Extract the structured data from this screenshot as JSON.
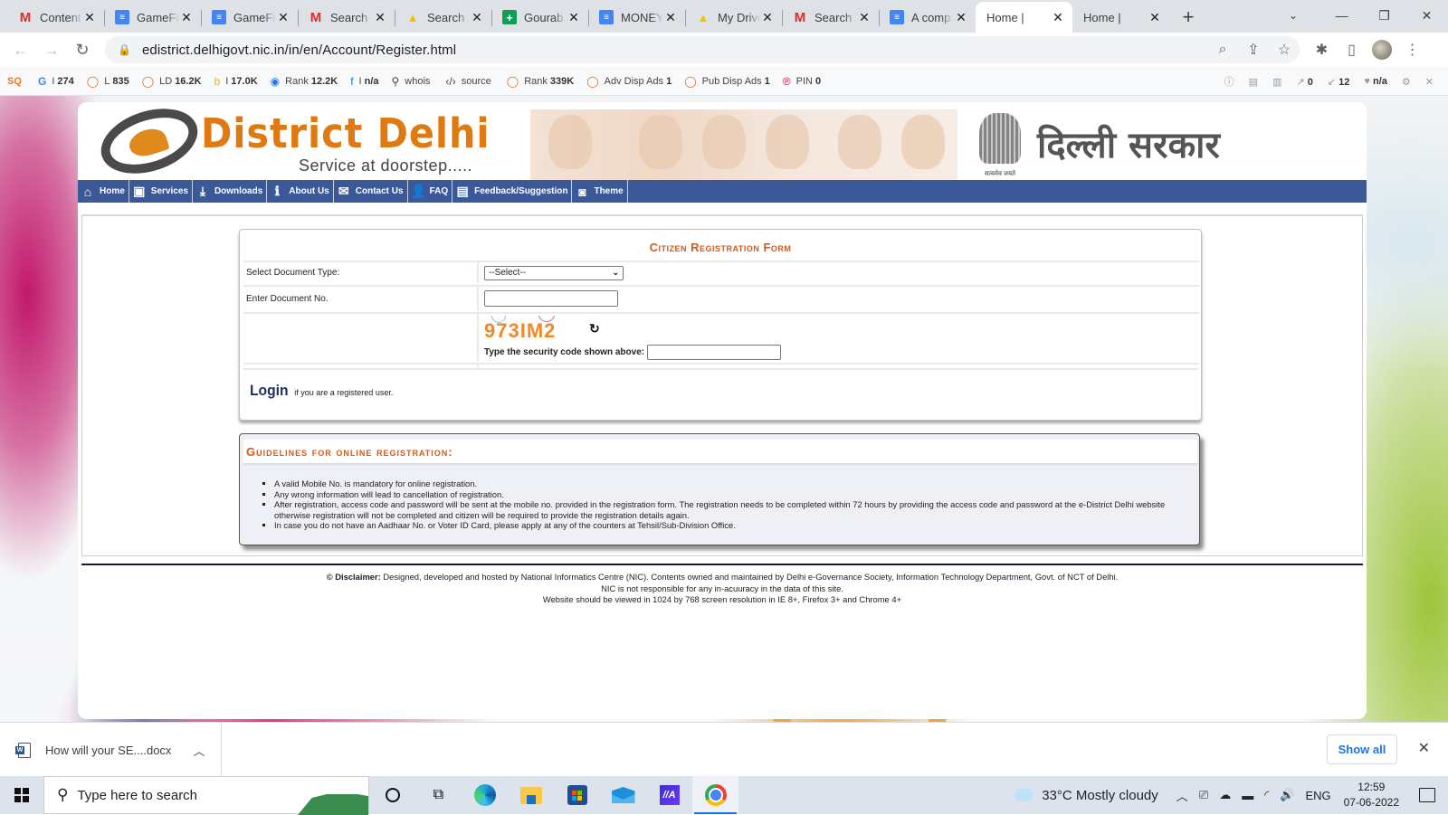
{
  "browser": {
    "tabs": [
      {
        "label": "Content",
        "favicon": "gmail-icon",
        "active": false
      },
      {
        "label": "GameFi",
        "favicon": "google-docs-icon",
        "active": false
      },
      {
        "label": "GameFi",
        "favicon": "google-docs-icon",
        "active": false
      },
      {
        "label": "Search",
        "favicon": "gmail-icon",
        "active": false
      },
      {
        "label": "Search",
        "favicon": "google-drive-icon",
        "active": false
      },
      {
        "label": "Gourab",
        "favicon": "google-sheets-icon",
        "active": false
      },
      {
        "label": "MONEY",
        "favicon": "google-docs-icon",
        "active": false
      },
      {
        "label": "My Drive",
        "favicon": "google-drive-icon",
        "active": false
      },
      {
        "label": "Search",
        "favicon": "gmail-icon",
        "active": false
      },
      {
        "label": "A comp",
        "favicon": "google-docs-icon",
        "active": false
      },
      {
        "label": "Home |",
        "favicon": "national-emblem-icon",
        "active": true
      },
      {
        "label": "Home |",
        "favicon": "national-emblem-icon",
        "active": false
      }
    ],
    "new_tab_label": "+",
    "close_glyph": "✕",
    "url": "edistrict.delhigovt.nic.in/in/en/Account/Register.html"
  },
  "seo_bar": {
    "items": [
      {
        "icon": "google-icon",
        "glyph": "G",
        "label": "I",
        "value": "274"
      },
      {
        "icon": "link-icon",
        "glyph": "◯",
        "label": "L",
        "value": "835"
      },
      {
        "icon": "link-icon",
        "glyph": "◯",
        "label": "LD",
        "value": "16.2K"
      },
      {
        "icon": "bing-icon",
        "glyph": "b",
        "label": "I",
        "value": "17.0K"
      },
      {
        "icon": "alexa-icon",
        "glyph": "◉",
        "label": "Rank",
        "value": "12.2K"
      },
      {
        "icon": "facebook-icon",
        "glyph": "f",
        "label": "I",
        "value": "n/a"
      },
      {
        "icon": "whois-icon",
        "glyph": "⚲",
        "label": "whois",
        "value": ""
      },
      {
        "icon": "source-icon",
        "glyph": "‹/›",
        "label": "source",
        "value": ""
      },
      {
        "icon": "rank-icon",
        "glyph": "◯",
        "label": "Rank",
        "value": "339K"
      },
      {
        "icon": "ads-icon",
        "glyph": "◯",
        "label": "Adv Disp Ads",
        "value": "1"
      },
      {
        "icon": "ads-icon",
        "glyph": "◯",
        "label": "Pub Disp Ads",
        "value": "1"
      },
      {
        "icon": "pinterest-icon",
        "glyph": "℗",
        "label": "PIN",
        "value": "0"
      }
    ],
    "right": {
      "external_links": "0",
      "internal_links": "12",
      "status": "n/a"
    }
  },
  "site": {
    "brand": "District Delhi",
    "tagline": "Service at doorstep.....",
    "govt_title": "दिल्ली सरकार",
    "emblem_motto": "सत्यमेव जयते",
    "nav": [
      {
        "label": "Home",
        "icon": "home-icon",
        "glyph": "⌂"
      },
      {
        "label": "Services",
        "icon": "briefcase-icon",
        "glyph": "▣"
      },
      {
        "label": "Downloads",
        "icon": "download-icon",
        "glyph": "⤓"
      },
      {
        "label": "About Us",
        "icon": "info-icon",
        "glyph": "ℹ"
      },
      {
        "label": "Contact Us",
        "icon": "mail-icon",
        "glyph": "✉"
      },
      {
        "label": "FAQ",
        "icon": "users-icon",
        "glyph": "👤"
      },
      {
        "label": "Feedback/Suggestion",
        "icon": "document-icon",
        "glyph": "▤"
      },
      {
        "label": "Theme",
        "icon": "camera-icon",
        "glyph": "◙"
      }
    ],
    "form": {
      "title": "Citizen Registration Form",
      "document_type_label": "Select Document Type:",
      "document_type_value": "--Select--",
      "document_no_label": "Enter Document No.",
      "document_no_value": "",
      "captcha_text": "973IM2",
      "security_code_label": "Type the security code shown above:",
      "security_code_value": "",
      "login_link": "Login",
      "login_note": "if you are a registered user."
    },
    "guidelines": {
      "title": "Guidelines for online registration:",
      "items": [
        "A valid Mobile No. is mandatory for online registration.",
        "Any wrong information will lead to cancellation of registration.",
        "After registration, access code and password will be sent at the mobile no. provided in the registration form. The registration needs to be completed within 72 hours by providing the access code and password at the e-District Delhi website otherwise registration will not be completed and citizen will be required to provide the registration details again.",
        "In case you do not have an Aadhaar No. or Voter ID Card, please apply at any of the counters at Tehsil/Sub-Division Office."
      ]
    },
    "footer": {
      "disclaimer_label": "© Disclaimer:",
      "disclaimer_text": " Designed, developed and hosted by National Informatics Centre (NIC). Contents owned and maintained by Delhi e-Governance Society, Information Technology Department, Govt. of NCT of Delhi.",
      "line2": "NIC is not responsible for any in-acuuracy in the data of this site.",
      "line3": "Website should be viewed in 1024 by 768 screen resolution in IE 8+, Firefox 3+ and Chrome 4+"
    }
  },
  "download_shelf": {
    "file_name": "How will your SE....docx",
    "show_all": "Show all"
  },
  "taskbar": {
    "search_placeholder": "Type here to search",
    "weather": "33°C  Mostly cloudy",
    "language": "ENG",
    "time": "12:59",
    "date": "07-06-2022"
  }
}
